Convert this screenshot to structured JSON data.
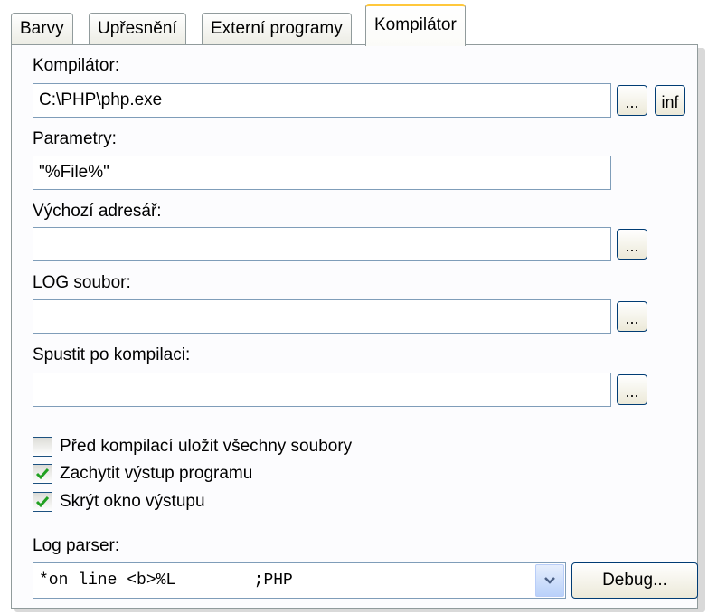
{
  "tabs": [
    {
      "label": "Barvy"
    },
    {
      "label": "Upřesnění"
    },
    {
      "label": "Externí programy"
    },
    {
      "label": "Kompilátor"
    }
  ],
  "compiler": {
    "label": "Kompilátor:",
    "value": "C:\\PHP\\php.exe",
    "browse_label": "...",
    "info_label": "inf"
  },
  "parameters": {
    "label": "Parametry:",
    "value": "\"%File%\""
  },
  "default_dir": {
    "label": "Výchozí adresář:",
    "value": "",
    "browse_label": "..."
  },
  "log_file": {
    "label": "LOG soubor:",
    "value": "",
    "browse_label": "..."
  },
  "run_after": {
    "label": "Spustit po kompilaci:",
    "value": "",
    "browse_label": "..."
  },
  "options": [
    {
      "label": "Před kompilací uložit všechny soubory",
      "checked": false
    },
    {
      "label": "Zachytit výstup programu",
      "checked": true
    },
    {
      "label": "Skrýt okno výstupu",
      "checked": true
    }
  ],
  "log_parser": {
    "label": "Log parser:",
    "value": "*on line <b>%L        ;PHP",
    "debug_label": "Debug..."
  },
  "colors": {
    "accent_tab": "#ffc83c",
    "field_border": "#7f9db9",
    "check_color": "#21a121"
  }
}
